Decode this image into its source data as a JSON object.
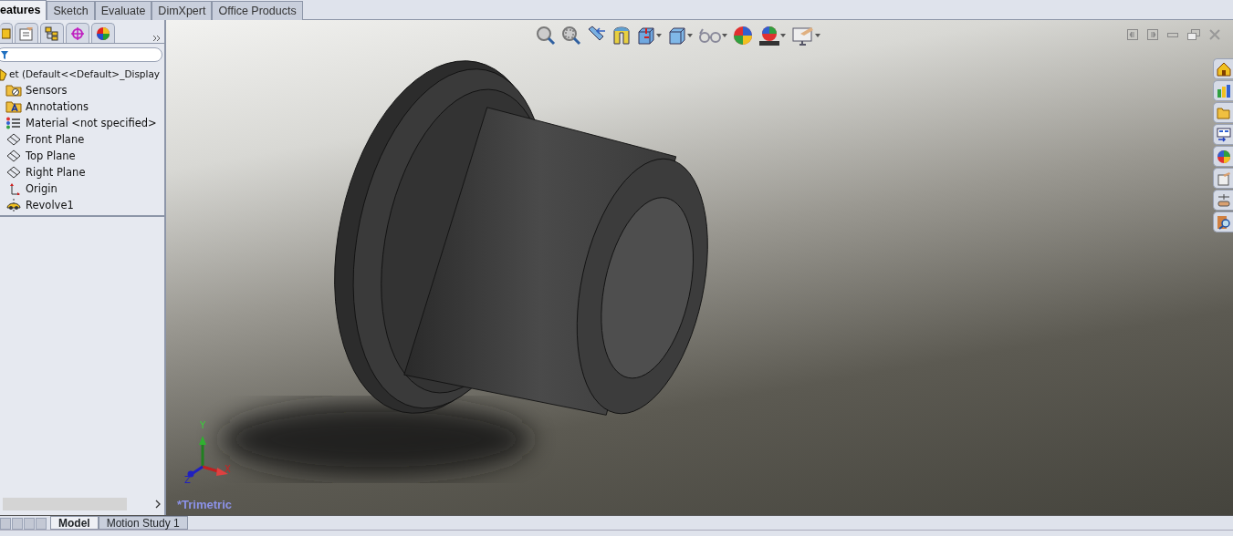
{
  "command_tabs": [
    {
      "label": "eatures",
      "selected": true
    },
    {
      "label": "Sketch",
      "selected": false
    },
    {
      "label": "Evaluate",
      "selected": false
    },
    {
      "label": "DimXpert",
      "selected": false
    },
    {
      "label": "Office Products",
      "selected": false
    }
  ],
  "feature_tree": {
    "root": "et  (Default<<Default>_Display",
    "items": [
      {
        "kind": "sensors",
        "label": "Sensors"
      },
      {
        "kind": "annotations",
        "label": "Annotations"
      },
      {
        "kind": "material",
        "label": "Material <not specified>"
      },
      {
        "kind": "plane",
        "label": "Front Plane"
      },
      {
        "kind": "plane",
        "label": "Top Plane"
      },
      {
        "kind": "plane",
        "label": "Right Plane"
      },
      {
        "kind": "origin",
        "label": "Origin"
      },
      {
        "kind": "revolve",
        "label": "Revolve1"
      }
    ]
  },
  "viewport": {
    "triad": {
      "x": "X",
      "y": "Y",
      "z": "Z"
    },
    "view_name": "*Trimetric"
  },
  "bottom_tabs": [
    {
      "label": "Model",
      "selected": true
    },
    {
      "label": "Motion Study 1",
      "selected": false
    }
  ]
}
